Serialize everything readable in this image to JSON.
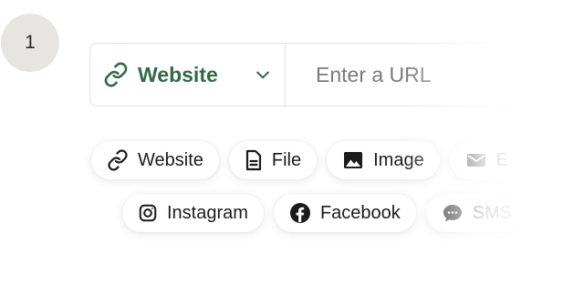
{
  "step": {
    "number": "1"
  },
  "source_selector": {
    "selected_label": "Website",
    "icon": "link-icon",
    "accent_color": "#2f6b45"
  },
  "url_input": {
    "placeholder": "Enter a URL",
    "value": ""
  },
  "chips": {
    "row1": [
      {
        "label": "Website",
        "icon": "link-icon"
      },
      {
        "label": "File",
        "icon": "file-icon"
      },
      {
        "label": "Image",
        "icon": "image-icon"
      },
      {
        "label": "E",
        "icon": "mail-icon"
      }
    ],
    "row2": [
      {
        "label": "Instagram",
        "icon": "instagram-icon"
      },
      {
        "label": "Facebook",
        "icon": "facebook-icon"
      },
      {
        "label": "SMS",
        "icon": "chat-icon"
      }
    ]
  }
}
